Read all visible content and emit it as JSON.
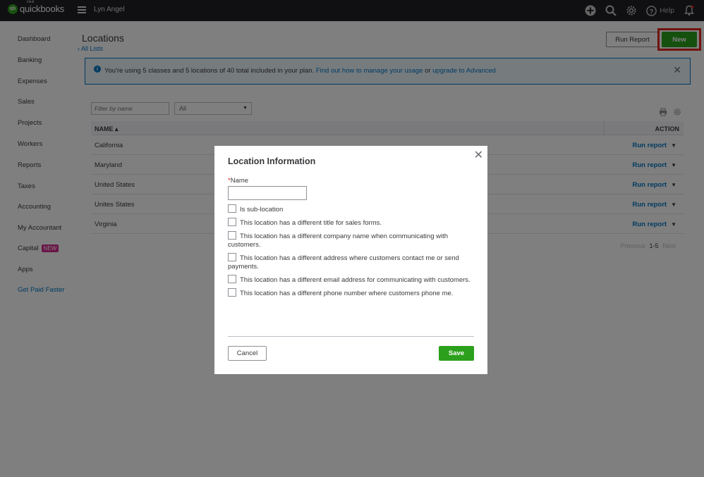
{
  "app": {
    "logo_small": "intuit",
    "logo_brand": "quickbooks",
    "company_name": "Lyn Angel",
    "help_label": "Help",
    "icons": [
      "plus-circle-icon",
      "search-icon",
      "gear-icon",
      "help-icon",
      "bell-icon"
    ]
  },
  "sidebar": {
    "items": [
      {
        "label": "Dashboard"
      },
      {
        "label": "Banking"
      },
      {
        "label": "Expenses"
      },
      {
        "label": "Sales"
      },
      {
        "label": "Projects"
      },
      {
        "label": "Workers"
      },
      {
        "label": "Reports"
      },
      {
        "label": "Taxes"
      },
      {
        "label": "Accounting"
      },
      {
        "label": "My Accountant"
      },
      {
        "label": "Capital",
        "badge": "NEW"
      },
      {
        "label": "Apps"
      },
      {
        "label": "Get Paid Faster"
      }
    ]
  },
  "page": {
    "title": "Locations",
    "back_link": "All Lists",
    "run_report_label": "Run Report",
    "new_label": "New"
  },
  "banner": {
    "text_prefix": "You're using 5 classes and 5 locations of 40 total included in your plan.",
    "link1": "Find out how to manage your usage",
    "text_or": "or",
    "link2": "upgrade to Advanced"
  },
  "list": {
    "filter_placeholder": "Filter by name",
    "filter_select_value": "All",
    "col_name": "NAME ▴",
    "col_action": "ACTION",
    "action_label": "Run report",
    "rows": [
      {
        "name": "California"
      },
      {
        "name": "Maryland"
      },
      {
        "name": "United States"
      },
      {
        "name": "Unites States"
      },
      {
        "name": "Virginia"
      }
    ],
    "pager_prev": "Previous",
    "pager_range": "1-5",
    "pager_next": "Next"
  },
  "modal": {
    "title": "Location Information",
    "name_label": "Name",
    "checkboxes": [
      "Is sub-location",
      "This location has a different title for sales forms.",
      "This location has a different company name when communicating with customers.",
      "This location has a different address where customers contact me or send payments.",
      "This location has a different email address for communicating with customers.",
      "This location has a different phone number where customers phone me."
    ],
    "cancel_label": "Cancel",
    "save_label": "Save"
  }
}
